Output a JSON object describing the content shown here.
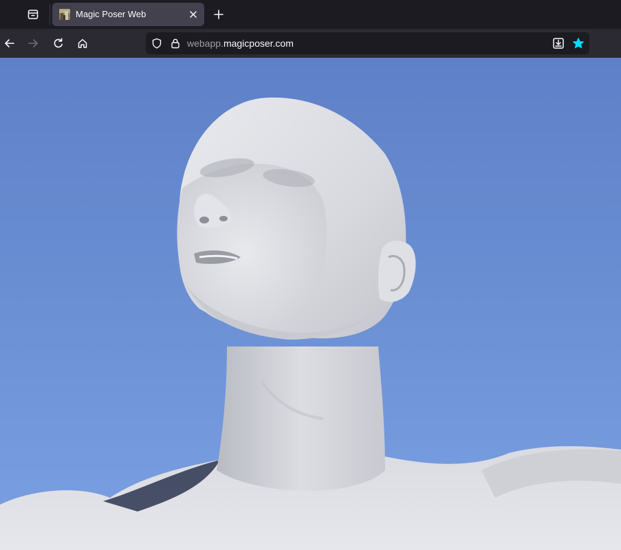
{
  "browser": {
    "tab": {
      "title": "Magic Poser Web",
      "favicon": "magic-poser-favicon"
    },
    "url": {
      "subdomain": "webapp.",
      "domain": "magicposer.com"
    },
    "icons": {
      "tab_list": "tab-list-icon",
      "close_tab": "close-icon",
      "new_tab": "plus-icon",
      "back": "arrow-left-icon",
      "forward": "arrow-right-icon",
      "reload": "reload-icon",
      "home": "home-icon",
      "tracking_protection": "shield-icon",
      "secure_connection": "lock-icon",
      "save_to_pocket": "download-icon",
      "bookmark": "star-icon"
    },
    "colors": {
      "tabstrip_bg": "#1c1b22",
      "toolbar_bg": "#2b2a33",
      "active_tab_bg": "#42414d",
      "bookmark_star": "#00ddff"
    }
  },
  "scene": {
    "subject": "3D mannequin head and shoulders",
    "sky_color_top": "#5e80c8",
    "sky_color_bottom": "#7ba0e3",
    "model_color": "#dcdde2"
  }
}
